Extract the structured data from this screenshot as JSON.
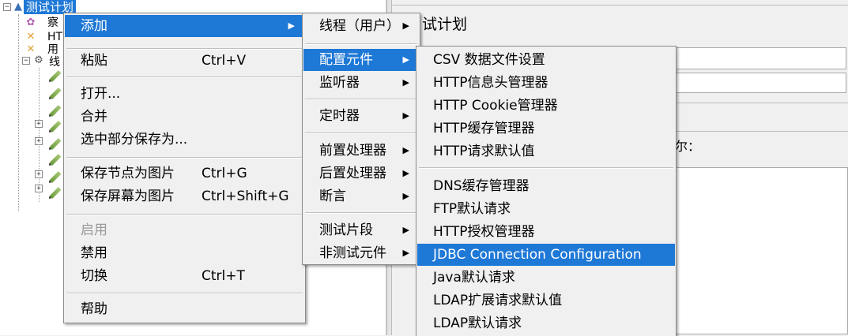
{
  "tree": {
    "root_label": "测试计划",
    "partial_labels": [
      "察",
      "HT",
      "用",
      "线"
    ]
  },
  "right_panel": {
    "title": "试计划",
    "name_label_fragment": "尔："
  },
  "menu_main": {
    "items": [
      {
        "label": "添加",
        "accel": "",
        "submenu": true,
        "selected": true,
        "disabled": false
      },
      {
        "label": "粘贴",
        "accel": "Ctrl+V",
        "submenu": false,
        "selected": false,
        "disabled": false
      },
      {
        "label": "打开...",
        "accel": "",
        "submenu": false,
        "selected": false,
        "disabled": false
      },
      {
        "label": "合并",
        "accel": "",
        "submenu": false,
        "selected": false,
        "disabled": false
      },
      {
        "label": "选中部分保存为...",
        "accel": "",
        "submenu": false,
        "selected": false,
        "disabled": false
      },
      {
        "label": "保存节点为图片",
        "accel": "Ctrl+G",
        "submenu": false,
        "selected": false,
        "disabled": false
      },
      {
        "label": "保存屏幕为图片",
        "accel": "Ctrl+Shift+G",
        "submenu": false,
        "selected": false,
        "disabled": false
      },
      {
        "label": "启用",
        "accel": "",
        "submenu": false,
        "selected": false,
        "disabled": true
      },
      {
        "label": "禁用",
        "accel": "",
        "submenu": false,
        "selected": false,
        "disabled": false
      },
      {
        "label": "切换",
        "accel": "Ctrl+T",
        "submenu": false,
        "selected": false,
        "disabled": false
      },
      {
        "label": "帮助",
        "accel": "",
        "submenu": false,
        "selected": false,
        "disabled": false
      }
    ]
  },
  "menu_add": {
    "items": [
      {
        "label": "线程（用户）",
        "submenu": true,
        "selected": false
      },
      {
        "label": "配置元件",
        "submenu": true,
        "selected": true
      },
      {
        "label": "监听器",
        "submenu": true,
        "selected": false
      },
      {
        "label": "定时器",
        "submenu": true,
        "selected": false
      },
      {
        "label": "前置处理器",
        "submenu": true,
        "selected": false
      },
      {
        "label": "后置处理器",
        "submenu": true,
        "selected": false
      },
      {
        "label": "断言",
        "submenu": true,
        "selected": false
      },
      {
        "label": "测试片段",
        "submenu": true,
        "selected": false
      },
      {
        "label": "非测试元件",
        "submenu": true,
        "selected": false
      }
    ]
  },
  "menu_config": {
    "items": [
      {
        "label": "CSV 数据文件设置",
        "selected": false
      },
      {
        "label": "HTTP信息头管理器",
        "selected": false
      },
      {
        "label": "HTTP Cookie管理器",
        "selected": false
      },
      {
        "label": "HTTP缓存管理器",
        "selected": false
      },
      {
        "label": "HTTP请求默认值",
        "selected": false
      },
      {
        "label": "DNS缓存管理器",
        "selected": false
      },
      {
        "label": "FTP默认请求",
        "selected": false
      },
      {
        "label": "HTTP授权管理器",
        "selected": false
      },
      {
        "label": "JDBC Connection Configuration",
        "selected": true
      },
      {
        "label": "Java默认请求",
        "selected": false
      },
      {
        "label": "LDAP扩展请求默认值",
        "selected": false
      },
      {
        "label": "LDAP默认请求",
        "selected": false
      }
    ]
  },
  "colors": {
    "selection": "#1e78d6",
    "menu_bg": "#f0f0f0",
    "disabled_text": "#9a9a9a"
  },
  "icons": {
    "submenu_arrow": "triangle-right-icon",
    "tree_expander": "plus-box-icon",
    "tree_node": "pencil-icon"
  }
}
